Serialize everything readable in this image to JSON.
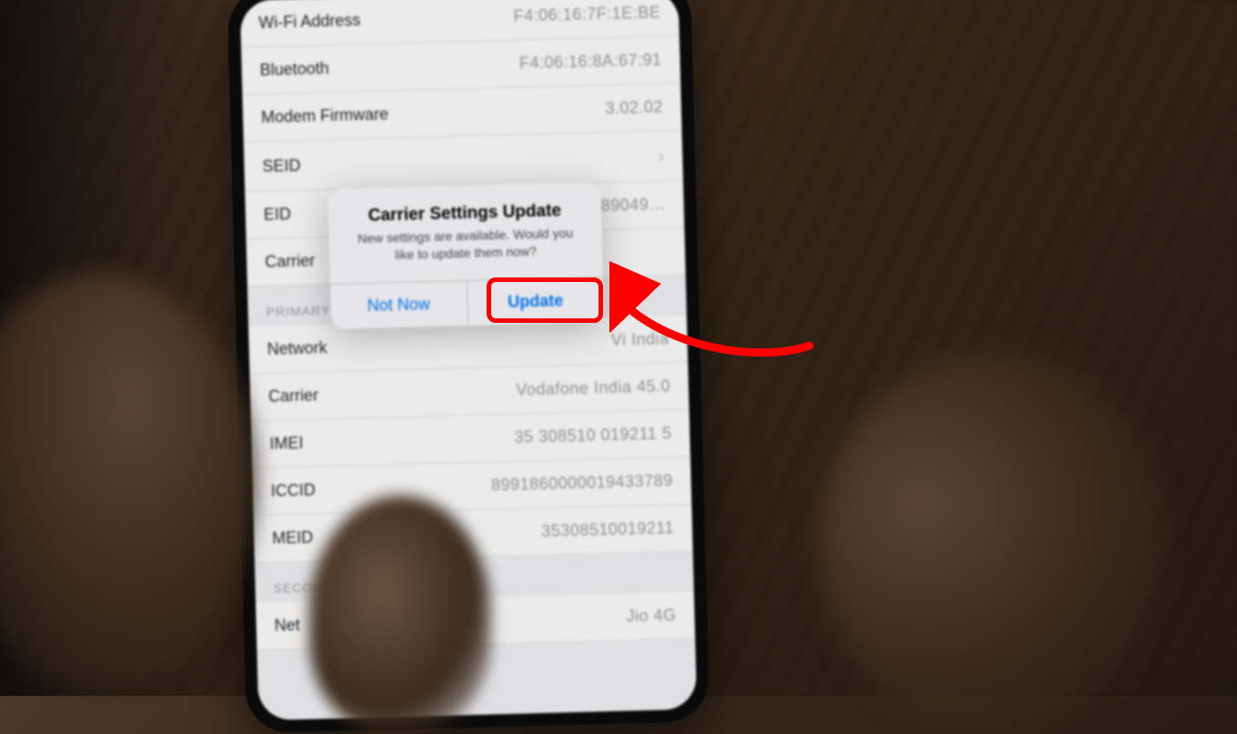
{
  "about": {
    "rows": [
      {
        "label": "Wi-Fi Address",
        "value": "F4:06:16:7F:1E:BE"
      },
      {
        "label": "Bluetooth",
        "value": "F4:06:16:8A:67:91"
      },
      {
        "label": "Modem Firmware",
        "value": "3.02.02"
      },
      {
        "label": "SEID",
        "value": "",
        "chevron": true
      },
      {
        "label": "EID",
        "value": "89049…"
      },
      {
        "label": "Carrier",
        "value": ""
      }
    ],
    "section_primary": "PRIMARY",
    "primary_rows": [
      {
        "label": "Network",
        "value": "Vi India"
      },
      {
        "label": "Carrier",
        "value": "Vodafone India 45.0"
      },
      {
        "label": "IMEI",
        "value": "35 308510 019211 5"
      },
      {
        "label": "ICCID",
        "value": "8991860000019433789"
      },
      {
        "label": "MEID",
        "value": "35308510019211"
      }
    ],
    "section_secondary": "SECOND",
    "secondary_rows": [
      {
        "label": "Net",
        "value": "Jio 4G"
      }
    ]
  },
  "dialog": {
    "title": "Carrier Settings Update",
    "message": "New settings are available. Would you like to update them now?",
    "not_now": "Not Now",
    "update": "Update"
  },
  "annotation": {
    "highlight_target": "update-button",
    "arrow_color": "#ff0000"
  }
}
